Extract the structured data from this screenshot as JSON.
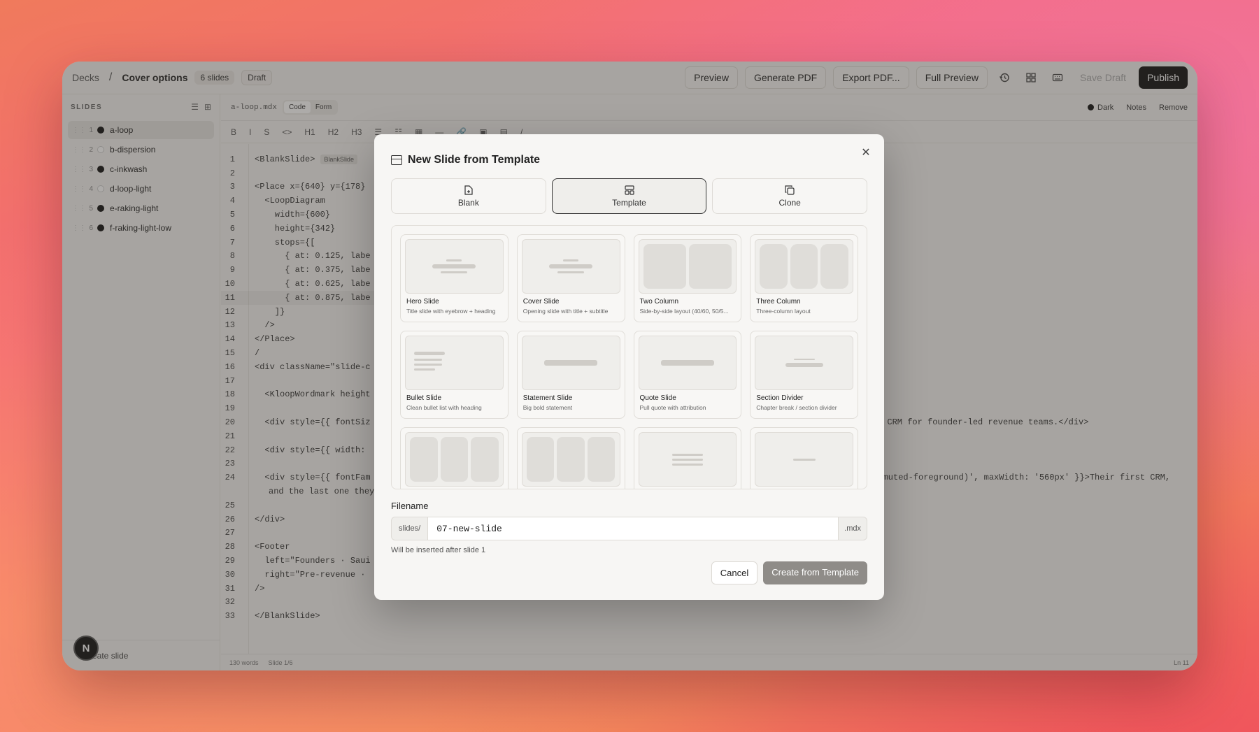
{
  "topbar": {
    "crumb_root": "Decks",
    "crumb_sep": "/",
    "crumb_current": "Cover options",
    "slides_badge": "6 slides",
    "status_badge": "Draft",
    "buttons": [
      "Preview",
      "Generate PDF",
      "Export PDF...",
      "Full Preview"
    ],
    "save_draft": "Save Draft",
    "publish": "Publish"
  },
  "sidebar": {
    "title": "SLIDES",
    "items": [
      {
        "num": "1",
        "label": "a-loop",
        "theme": "dark",
        "active": true
      },
      {
        "num": "2",
        "label": "b-dispersion",
        "theme": "light",
        "active": false
      },
      {
        "num": "3",
        "label": "c-inkwash",
        "theme": "dark",
        "active": false
      },
      {
        "num": "4",
        "label": "d-loop-light",
        "theme": "light",
        "active": false
      },
      {
        "num": "5",
        "label": "e-raking-light",
        "theme": "dark",
        "active": false
      },
      {
        "num": "6",
        "label": "f-raking-light-low",
        "theme": "dark",
        "active": false
      }
    ],
    "footer": "+ Create slide",
    "avatar": "N"
  },
  "editor": {
    "filename": "a-loop.mdx",
    "mode_code": "Code",
    "mode_form": "Form",
    "theme_label": "Dark",
    "notes": "Notes",
    "remove": "Remove",
    "tools": [
      "B",
      "I",
      "S",
      "<>",
      "H1",
      "H2",
      "H3",
      "☰",
      "☷",
      "▦",
      "—",
      "🔗",
      "▣",
      "▤",
      "/"
    ],
    "lines": [
      {
        "n": "1",
        "t": "<BlankSlide>",
        "badge": "BlankSlide"
      },
      {
        "n": "2",
        "t": ""
      },
      {
        "n": "3",
        "t": "<Place x={640} y={178}"
      },
      {
        "n": "4",
        "t": "  <LoopDiagram"
      },
      {
        "n": "5",
        "t": "    width={600}"
      },
      {
        "n": "6",
        "t": "    height={342}"
      },
      {
        "n": "7",
        "t": "    stops={["
      },
      {
        "n": "8",
        "t": "      { at: 0.125, labe"
      },
      {
        "n": "9",
        "t": "      { at: 0.375, labe"
      },
      {
        "n": "10",
        "t": "      { at: 0.625, labe"
      },
      {
        "n": "11",
        "t": "      { at: 0.875, labe"
      },
      {
        "n": "12",
        "t": "    ]}"
      },
      {
        "n": "13",
        "t": "  />"
      },
      {
        "n": "14",
        "t": "</Place>"
      },
      {
        "n": "15",
        "t": "/"
      },
      {
        "n": "16",
        "t": "<div className=\"slide-c"
      },
      {
        "n": "17",
        "t": ""
      },
      {
        "n": "18",
        "t": "  <KloopWordmark height"
      },
      {
        "n": "19",
        "t": ""
      },
      {
        "n": "20",
        "t": "  <div style={{ fontSiz",
        "tail": "t CRM for founder-led revenue teams.</div>"
      },
      {
        "n": "21",
        "t": ""
      },
      {
        "n": "22",
        "t": "  <div style={{ width:"
      },
      {
        "n": "23",
        "t": ""
      },
      {
        "n": "24",
        "t": "  <div style={{ fontFam",
        "tail": "(--muted-foreground)', maxWidth: '560px' }}>Their first CRM,"
      },
      {
        "n": "",
        "t": "and the last one they h"
      },
      {
        "n": "25",
        "t": ""
      },
      {
        "n": "26",
        "t": "</div>"
      },
      {
        "n": "27",
        "t": ""
      },
      {
        "n": "28",
        "t": "<Footer"
      },
      {
        "n": "29",
        "t": "  left=\"Founders · Saui"
      },
      {
        "n": "30",
        "t": "  right=\"Pre-revenue ·"
      },
      {
        "n": "31",
        "t": "/>"
      },
      {
        "n": "32",
        "t": ""
      },
      {
        "n": "33",
        "t": "</BlankSlide>"
      }
    ],
    "status_words": "130 words",
    "status_slide": "Slide 1/6",
    "status_ln": "Ln 11"
  },
  "modal": {
    "title": "New Slide from Template",
    "tabs": [
      {
        "label": "Blank",
        "icon": "file-plus-icon"
      },
      {
        "label": "Template",
        "icon": "layout-icon",
        "active": true
      },
      {
        "label": "Clone",
        "icon": "copy-icon"
      }
    ],
    "templates": [
      {
        "name": "Hero Slide",
        "desc": "Title slide with eyebrow + heading"
      },
      {
        "name": "Cover Slide",
        "desc": "Opening slide with title + subtitle"
      },
      {
        "name": "Two Column",
        "desc": "Side-by-side layout (40/60, 50/5..."
      },
      {
        "name": "Three Column",
        "desc": "Three-column layout"
      },
      {
        "name": "Bullet Slide",
        "desc": "Clean bullet list with heading"
      },
      {
        "name": "Statement Slide",
        "desc": "Big bold statement"
      },
      {
        "name": "Quote Slide",
        "desc": "Pull quote with attribution"
      },
      {
        "name": "Section Divider",
        "desc": "Chapter break / section divider"
      }
    ],
    "filename_label": "Filename",
    "filename_prefix": "slides/",
    "filename_value": "07-new-slide",
    "filename_suffix": ".mdx",
    "hint": "Will be inserted after slide 1",
    "cancel": "Cancel",
    "create": "Create from Template"
  }
}
